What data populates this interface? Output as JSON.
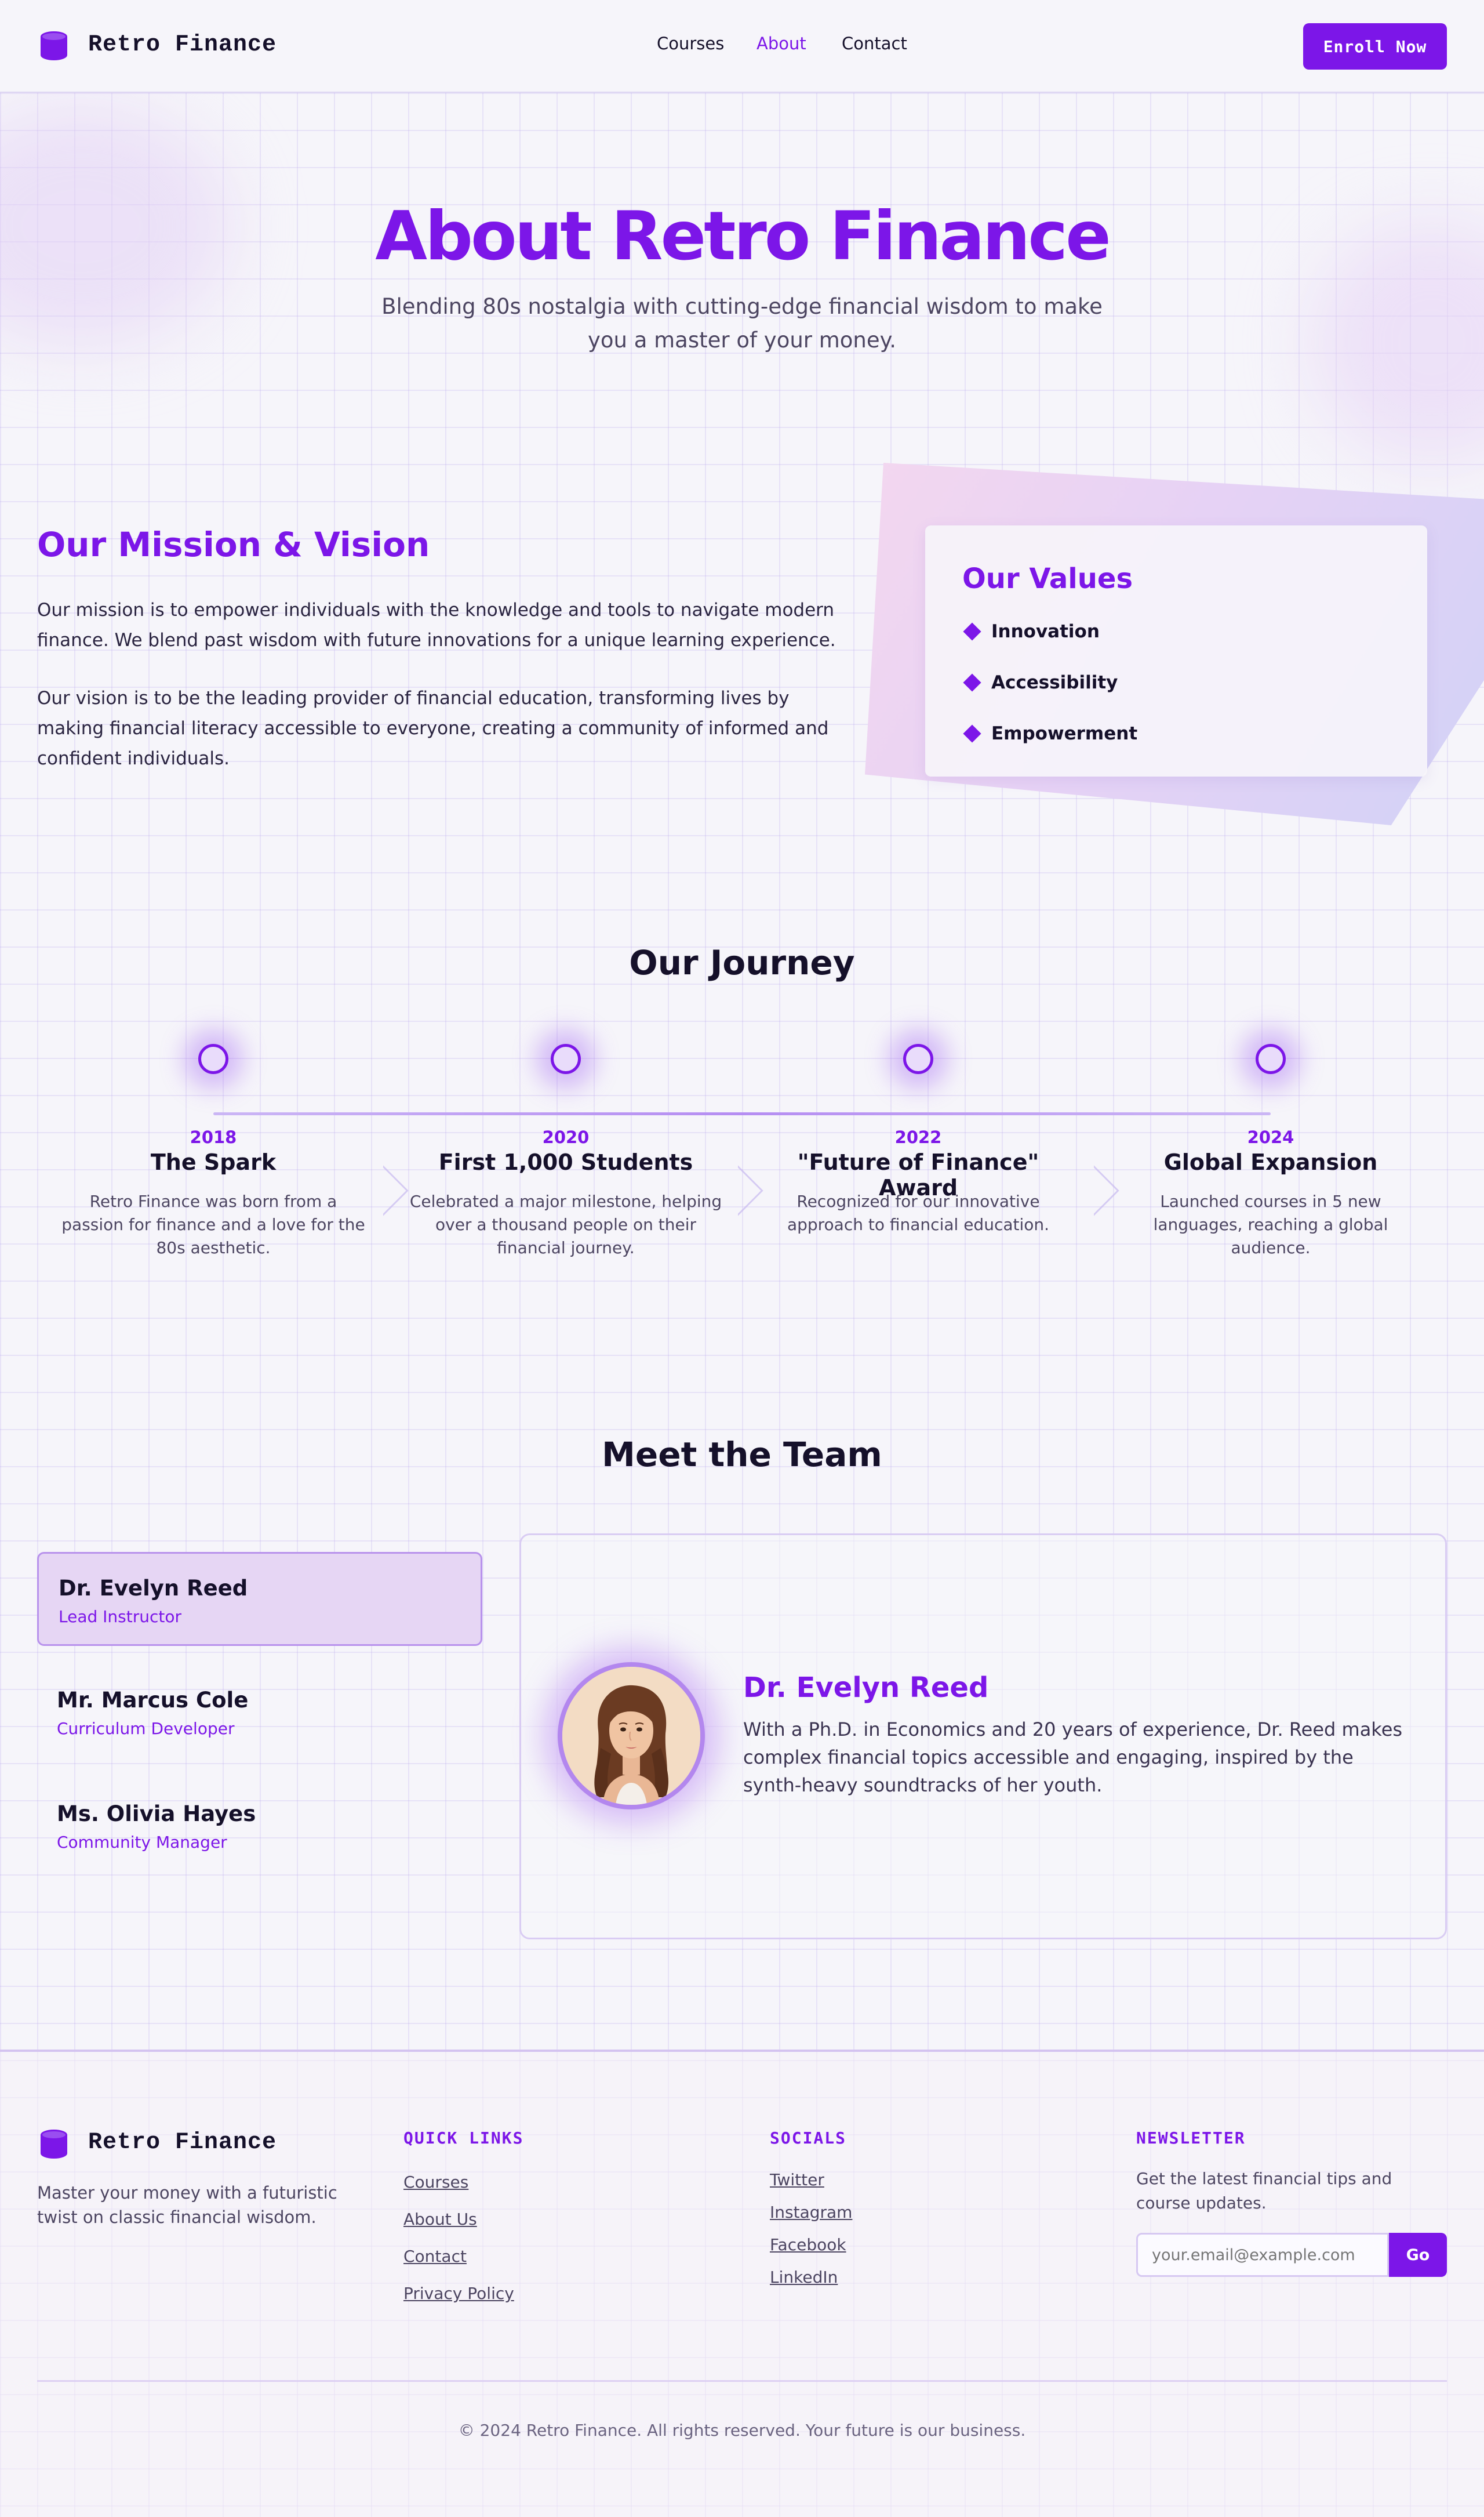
{
  "brand": {
    "name": "Retro Finance"
  },
  "nav": {
    "items": [
      {
        "label": "Courses"
      },
      {
        "label": "About"
      },
      {
        "label": "Contact"
      }
    ],
    "active": "About",
    "cta_label": "Enroll Now"
  },
  "hero": {
    "title": "About Retro Finance",
    "subtitle": "Blending 80s nostalgia with cutting-edge financial wisdom to make you a master of your money."
  },
  "mission": {
    "heading": "Our Mission & Vision",
    "paragraphs": [
      "Our mission is to empower individuals with the knowledge and tools to navigate modern finance. We blend past wisdom with future innovations for a unique learning experience.",
      "Our vision is to be the leading provider of financial education, transforming lives by making financial literacy accessible to everyone, creating a community of informed and confident individuals."
    ]
  },
  "values": {
    "heading": "Our Values",
    "items": [
      "Innovation",
      "Accessibility",
      "Empowerment"
    ]
  },
  "journey": {
    "heading": "Our Journey",
    "events": [
      {
        "year": "2018",
        "title": "The Spark",
        "description": "Retro Finance was born from a passion for finance and a love for the 80s aesthetic."
      },
      {
        "year": "2020",
        "title": "First 1,000 Students",
        "description": "Celebrated a major milestone, helping over a thousand people on their financial journey."
      },
      {
        "year": "2022",
        "title": "\"Future of Finance\" Award",
        "description": "Recognized for our innovative approach to financial education."
      },
      {
        "year": "2024",
        "title": "Global Expansion",
        "description": "Launched courses in 5 new languages, reaching a global audience."
      }
    ]
  },
  "team": {
    "heading": "Meet the Team",
    "members": [
      {
        "name": "Dr. Evelyn Reed",
        "role": "Lead Instructor"
      },
      {
        "name": "Mr. Marcus Cole",
        "role": "Curriculum Developer"
      },
      {
        "name": "Ms. Olivia Hayes",
        "role": "Community Manager"
      }
    ],
    "selected": {
      "name": "Dr. Evelyn Reed",
      "bio": "With a Ph.D. in Economics and 20 years of experience, Dr. Reed makes complex financial topics accessible and engaging, inspired by the synth-heavy soundtracks of her youth.",
      "avatar_icon": "woman-portrait"
    }
  },
  "footer": {
    "tagline": "Master your money with a futuristic twist on classic financial wisdom.",
    "quick_links": {
      "heading": "QUICK LINKS",
      "links": [
        "Courses",
        "About Us",
        "Contact",
        "Privacy Policy"
      ]
    },
    "socials": {
      "heading": "SOCIALS",
      "links": [
        "Twitter",
        "Instagram",
        "Facebook",
        "LinkedIn"
      ]
    },
    "newsletter": {
      "heading": "NEWSLETTER",
      "text": "Get the latest financial tips and course updates.",
      "placeholder": "your.email@example.com",
      "button_label": "Go"
    },
    "copyright": "© 2024 Retro Finance. All rights reserved. Your future is our business."
  },
  "colors": {
    "accent": "#7c16e8",
    "text": "#15102a",
    "muted": "#4c4561",
    "background": "#f6f5fa"
  }
}
